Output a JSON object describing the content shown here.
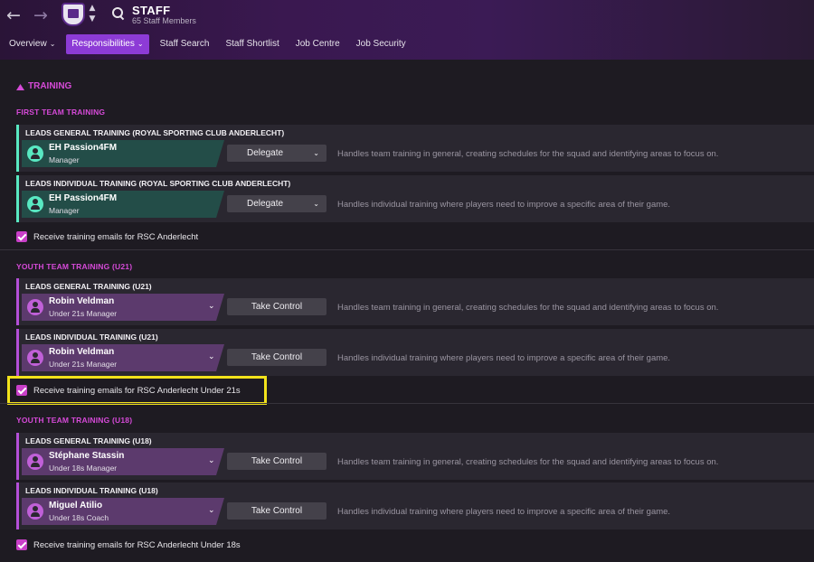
{
  "header": {
    "title": "STAFF",
    "subtitle": "65 Staff Members",
    "back_icon": "←",
    "forward_icon": "→",
    "updown_icon": "⌃⌄"
  },
  "tabs": [
    {
      "label": "Overview",
      "chev": "⌄"
    },
    {
      "label": "Responsibilities",
      "chev": "⌄"
    },
    {
      "label": "Staff Search"
    },
    {
      "label": "Staff Shortlist"
    },
    {
      "label": "Job Centre"
    },
    {
      "label": "Job Security"
    }
  ],
  "section_title": "TRAINING",
  "groups": [
    {
      "title": "FIRST TEAM TRAINING",
      "rows": [
        {
          "title": "LEADS GENERAL TRAINING (ROYAL SPORTING CLUB ANDERLECHT)",
          "name": "EH Passion4FM",
          "role": "Manager",
          "button": "Delegate",
          "desc": "Handles team training in general, creating schedules for the squad and identifying areas to focus on."
        },
        {
          "title": "LEADS INDIVIDUAL TRAINING (ROYAL SPORTING CLUB ANDERLECHT)",
          "name": "EH Passion4FM",
          "role": "Manager",
          "button": "Delegate",
          "desc": "Handles individual training where players need to improve a specific area of their game."
        }
      ],
      "checkbox": "Receive training emails for RSC Anderlecht"
    },
    {
      "title": "YOUTH TEAM TRAINING (U21)",
      "rows": [
        {
          "title": "LEADS GENERAL TRAINING (U21)",
          "name": "Robin Veldman",
          "role": "Under 21s Manager",
          "button": "Take Control",
          "desc": "Handles team training in general, creating schedules for the squad and identifying areas to focus on."
        },
        {
          "title": "LEADS INDIVIDUAL TRAINING (U21)",
          "name": "Robin Veldman",
          "role": "Under 21s Manager",
          "button": "Take Control",
          "desc": "Handles individual training where players need to improve a specific area of their game."
        }
      ],
      "checkbox": "Receive training emails for RSC Anderlecht Under 21s"
    },
    {
      "title": "YOUTH TEAM TRAINING (U18)",
      "rows": [
        {
          "title": "LEADS GENERAL TRAINING (U18)",
          "name": "Stéphane Stassin",
          "role": "Under 18s Manager",
          "button": "Take Control",
          "desc": "Handles team training in general, creating schedules for the squad and identifying areas to focus on."
        },
        {
          "title": "LEADS INDIVIDUAL TRAINING (U18)",
          "name": "Miguel Atilio",
          "role": "Under 18s Coach",
          "button": "Take Control",
          "desc": "Handles individual training where players need to improve a specific area of their game."
        }
      ],
      "checkbox": "Receive training emails for RSC Anderlecht Under 18s"
    }
  ],
  "chev": "⌄",
  "colors": {
    "accent_first_team": "#59e8c2",
    "accent_youth": "#b44fd8",
    "tab_active": "#8d3bd6",
    "highlight": "#f2e21b"
  }
}
